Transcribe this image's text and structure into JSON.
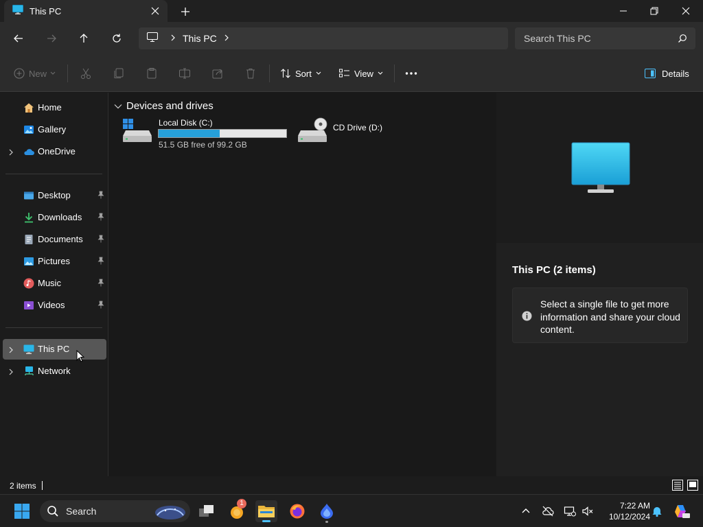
{
  "window": {
    "tab_title": "This PC",
    "breadcrumb": [
      "This PC"
    ]
  },
  "search": {
    "placeholder": "Search This PC"
  },
  "commands": {
    "new_label": "New",
    "sort_label": "Sort",
    "view_label": "View",
    "details_label": "Details"
  },
  "sidebar": {
    "quick": [
      {
        "label": "Home",
        "icon": "home-icon"
      },
      {
        "label": "Gallery",
        "icon": "gallery-icon"
      },
      {
        "label": "OneDrive",
        "icon": "onedrive-icon"
      }
    ],
    "pinned": [
      {
        "label": "Desktop",
        "icon": "desktop-folder-icon"
      },
      {
        "label": "Downloads",
        "icon": "downloads-icon"
      },
      {
        "label": "Documents",
        "icon": "documents-icon"
      },
      {
        "label": "Pictures",
        "icon": "pictures-icon"
      },
      {
        "label": "Music",
        "icon": "music-icon"
      },
      {
        "label": "Videos",
        "icon": "videos-icon"
      }
    ],
    "locations": [
      {
        "label": "This PC",
        "icon": "this-pc-icon",
        "selected": true
      },
      {
        "label": "Network",
        "icon": "network-icon"
      }
    ]
  },
  "content": {
    "group_title": "Devices and drives",
    "drives": [
      {
        "name": "Local Disk (C:)",
        "free_text": "51.5 GB free of 99.2 GB",
        "used_fraction": 0.48
      },
      {
        "name": "CD Drive (D:)"
      }
    ]
  },
  "details": {
    "title": "This PC (2 items)",
    "info": "Select a single file to get more information and share your cloud content."
  },
  "status": {
    "item_count": "2 items"
  },
  "taskbar": {
    "search_label": "Search",
    "badge": "1",
    "time": "7:22 AM",
    "date": "10/12/2024"
  },
  "colors": {
    "accent": "#26a0da",
    "selection": "#575757",
    "background": "#191919"
  }
}
